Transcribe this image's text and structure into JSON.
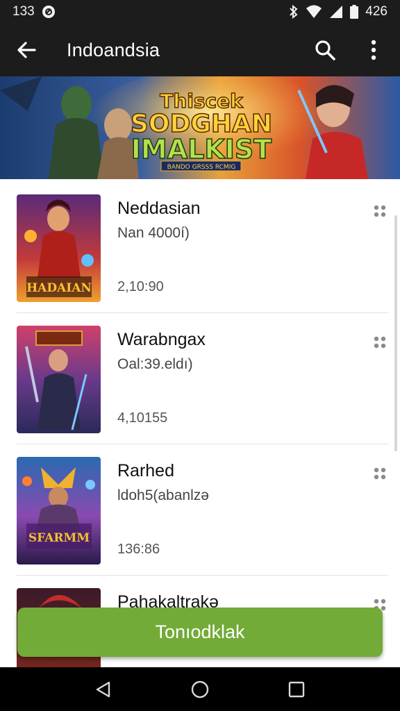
{
  "status_bar": {
    "time": "133",
    "battery_text": "426",
    "icons": [
      "notification-icon",
      "bluetooth-icon",
      "wifi-icon",
      "signal-icon",
      "battery-icon"
    ]
  },
  "app_bar": {
    "title": "Indoandsia",
    "icons": [
      "back-arrow-icon",
      "search-icon",
      "more-vert-icon"
    ]
  },
  "banner": {
    "line1": "Thiscek",
    "line2": "SODGHAN",
    "line3": "IMALKIST",
    "tagline": "BANDO GRSSS RCMIG"
  },
  "items": [
    {
      "title": "Neddasian",
      "subtitle": "Nan 4000í)",
      "meta": "2,10:90",
      "thumb_label": "HADAIAN"
    },
    {
      "title": "Warabngax",
      "subtitle": "Oal:39.eldı)",
      "meta": "4,10155",
      "thumb_label": ""
    },
    {
      "title": "Rarhed",
      "subtitle": "ldoh5(abanlzə",
      "meta": "136:86",
      "thumb_label": "SFARMM"
    },
    {
      "title": "Pahakaltrakə",
      "subtitle": "",
      "meta": "",
      "thumb_label": ""
    }
  ],
  "cta": {
    "label": "Tonıodklak"
  },
  "colors": {
    "bar": "#1c1c1c",
    "accent": "#72ab37",
    "nav": "#000000"
  },
  "nav": {
    "icons": [
      "back-triangle-icon",
      "home-circle-icon",
      "recents-square-icon"
    ]
  }
}
